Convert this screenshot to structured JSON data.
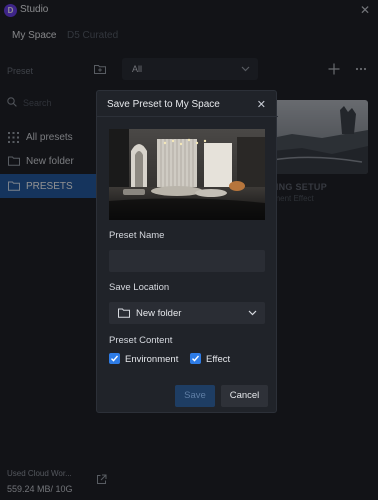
{
  "app": {
    "logo_letter": "D",
    "title": "Studio",
    "brand_color": "#6b3df0"
  },
  "tabs": {
    "my_space": "My Space",
    "d5_curated": "D5 Curated"
  },
  "sidebar": {
    "preset_label": "Preset",
    "search_placeholder": "Search",
    "items": [
      {
        "label": "All presets",
        "icon": "grid-icon"
      },
      {
        "label": "New folder",
        "icon": "folder-icon"
      },
      {
        "label": "PRESETS",
        "icon": "folder-icon",
        "selected": true
      }
    ],
    "cloud": {
      "label": "Used Cloud Wor...",
      "usage": "559.24 MB/ 10G"
    }
  },
  "toolbar": {
    "filter_value": "All"
  },
  "card": {
    "title": "NING SETUP",
    "subtitle": "nment Effect"
  },
  "modal": {
    "title": "Save Preset to My Space",
    "preset_name_label": "Preset Name",
    "preset_name_value": "",
    "save_location_label": "Save Location",
    "save_location_value": "New folder",
    "preset_content_label": "Preset Content",
    "checkboxes": [
      {
        "label": "Environment",
        "checked": true
      },
      {
        "label": "Effect",
        "checked": true
      }
    ],
    "save_label": "Save",
    "cancel_label": "Cancel",
    "accent_color": "#2e7ce6"
  }
}
